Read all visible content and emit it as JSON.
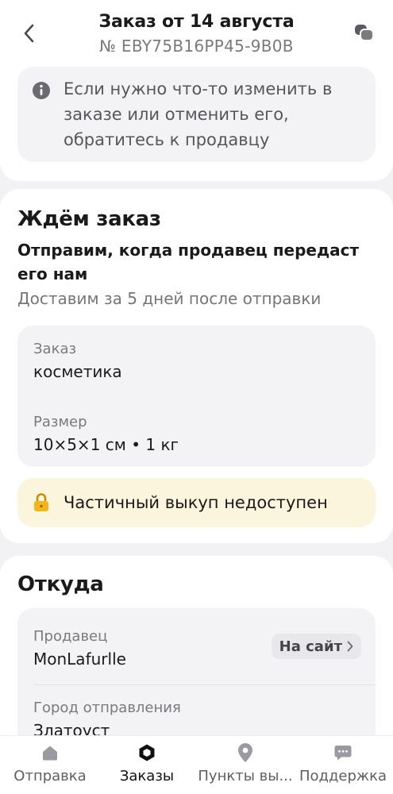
{
  "header": {
    "title": "Заказ от 14 августа",
    "order_number": "№ EBY75B16PP45-9B0B"
  },
  "info_banner": {
    "text": "Если нужно что-то изменить в заказе или отменить его, обратитесь к продавцу"
  },
  "status": {
    "heading": "Ждём заказ",
    "line1": "Отправим, когда продавец передаст",
    "line2": "его нам",
    "delivery_note": "Доставим за 5 дней после отправки"
  },
  "details": {
    "order_label": "Заказ",
    "order_value": "косметика",
    "size_label": "Размер",
    "size_value": "10×5×1 см • 1 кг"
  },
  "warning": {
    "text": "Частичный выкуп недоступен"
  },
  "origin": {
    "heading": "Откуда",
    "seller_label": "Продавец",
    "seller_value": "MonLafurlle",
    "site_button": "На сайт",
    "city_label": "Город отправления",
    "city_value": "Златоуст"
  },
  "nav": {
    "items": [
      {
        "label": "Отправка",
        "icon": "home-icon"
      },
      {
        "label": "Заказы",
        "icon": "orders-icon"
      },
      {
        "label": "Пункты вы...",
        "icon": "location-pin-icon"
      },
      {
        "label": "Поддержка",
        "icon": "chat-bubble-icon"
      }
    ],
    "active_index": 1
  },
  "colors": {
    "accent_text": "#1a1a1a",
    "warning_bg": "#fcf5de",
    "lock_icon": "#f2b51c",
    "panel_bg": "#f3f3f6"
  }
}
